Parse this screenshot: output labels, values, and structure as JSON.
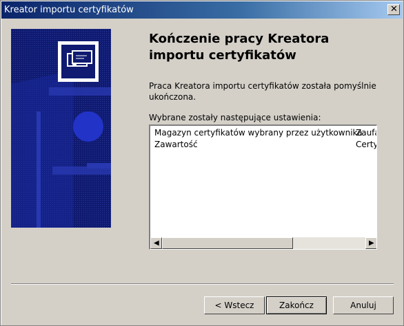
{
  "window": {
    "title": "Kreator importu certyfikatów"
  },
  "close_button": {
    "symbol": "✕",
    "icon": "close-icon"
  },
  "wizard": {
    "heading_line1": "Kończenie pracy Kreatora",
    "heading_line2": "importu certyfikatów",
    "body_line1": "Praca Kreatora importu certyfikatów została pomyślnie",
    "body_line2": "ukończona.",
    "settings_label": "Wybrane zostały następujące ustawienia:"
  },
  "settings_list": {
    "rows": [
      {
        "name": "Magazyn certyfikatów wybrany przez użytkownika",
        "value": "Zaufa"
      },
      {
        "name": "Zawartość",
        "value": "Certy"
      }
    ]
  },
  "buttons": {
    "back": "< Wstecz",
    "finish": "Zakończ",
    "cancel": "Anuluj"
  },
  "colors": {
    "title_bar": "#0a246a",
    "banner": "#0f1a70",
    "window": "#d4d0c8"
  }
}
